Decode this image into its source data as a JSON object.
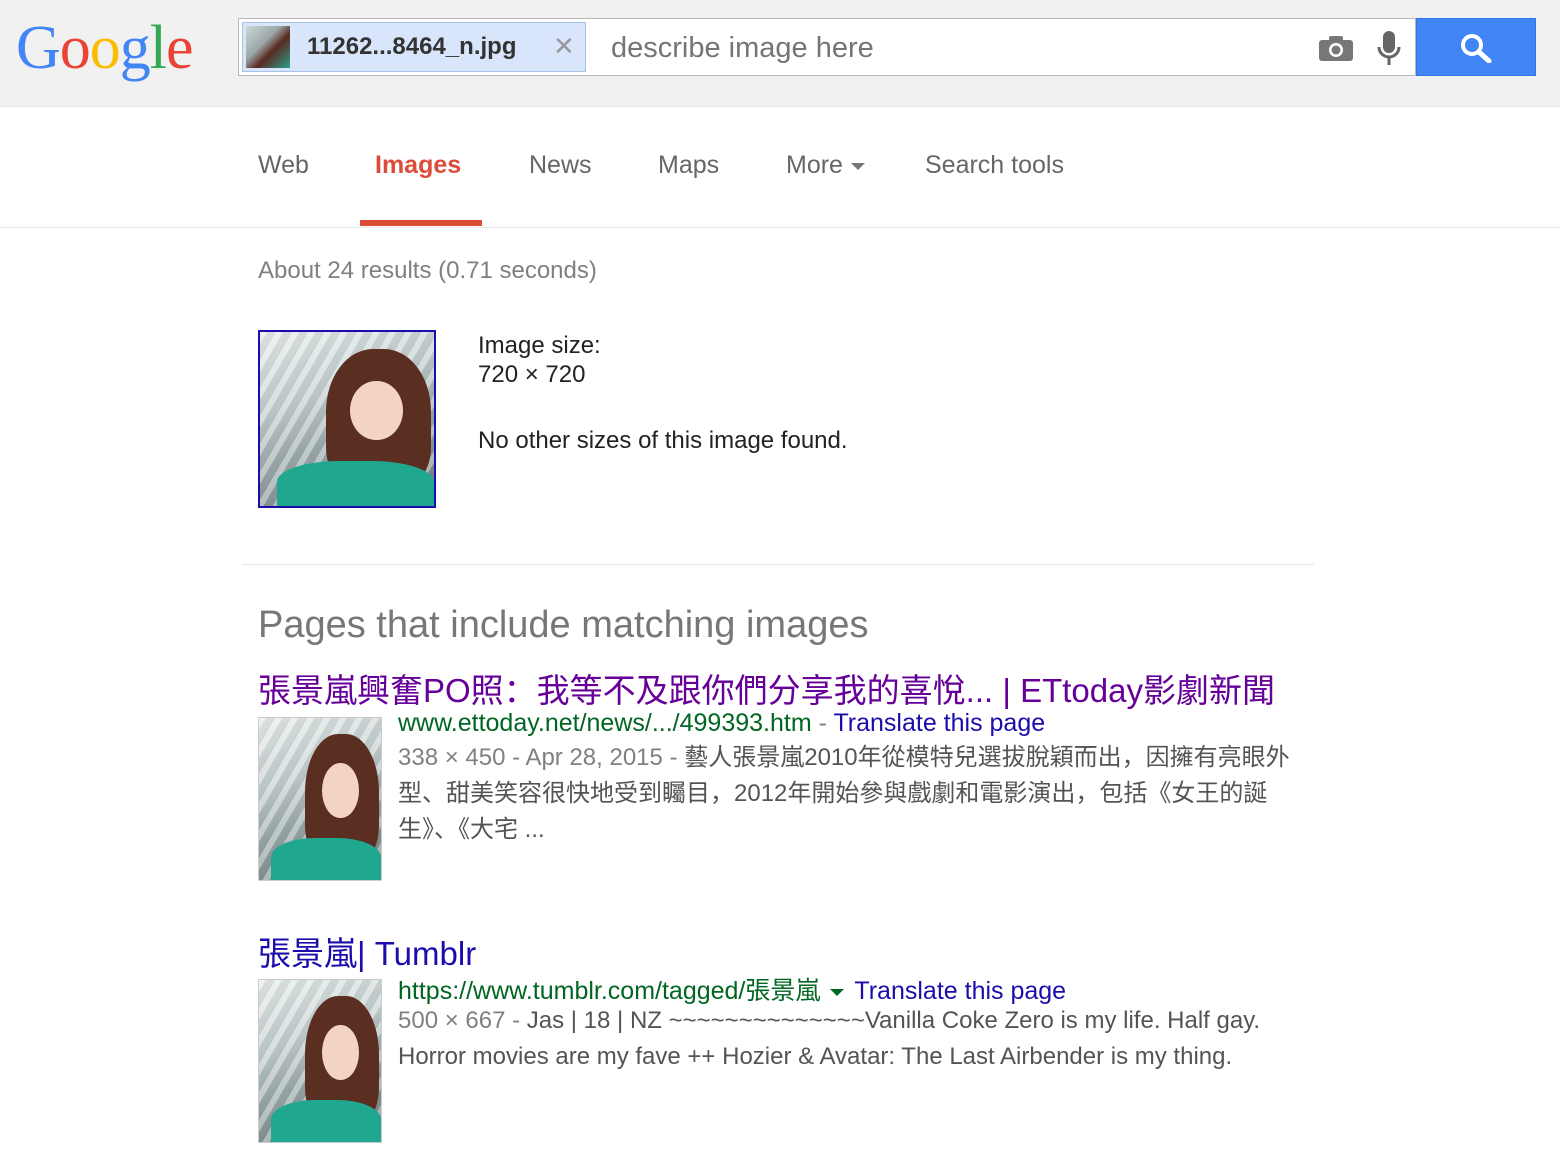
{
  "logo": {
    "text": "Google"
  },
  "search": {
    "chip_filename": "11262...8464_n.jpg",
    "placeholder": "describe image here",
    "value": ""
  },
  "tabs": [
    {
      "label": "Web",
      "active": false
    },
    {
      "label": "Images",
      "active": true
    },
    {
      "label": "News",
      "active": false
    },
    {
      "label": "Maps",
      "active": false
    },
    {
      "label": "More",
      "active": false
    },
    {
      "label": "Search tools",
      "active": false
    }
  ],
  "stats": "About 24 results (0.71 seconds)",
  "image_info": {
    "label": "Image size:",
    "size": "720 × 720",
    "note": "No other sizes of this image found."
  },
  "section_title": "Pages that include matching images",
  "results": [
    {
      "title": "張景嵐興奮PO照：我等不及跟你們分享我的喜悅... | ETtoday影劇新聞",
      "url": "www.ettoday.net/news/.../499393.htm",
      "sep": " - ",
      "translate": "Translate this page",
      "meta": "338 × 450 - Apr 28, 2015 - ",
      "snippet": "藝人張景嵐2010年從模特兒選拔脫穎而出，因擁有亮眼外型、甜美笑容很快地受到矚目，2012年開始參與戲劇和電影演出，包括《女王的誕生》、《大宅 ..."
    },
    {
      "title": "張景嵐| Tumblr",
      "url": "https://www.tumblr.com/tagged/張景嵐",
      "translate": "Translate this page",
      "meta": "500 × 667 - ",
      "snippet": "Jas | 18 | NZ ~~~~~~~~~~~~~~Vanilla Coke Zero is my life. Half gay. Horror movies are my fave ++ Hozier & Avatar: The Last Airbender is my thing."
    }
  ],
  "colors": {
    "active_tab": "#dd4b39",
    "link": "#1a0dab",
    "visited": "#660099",
    "url": "#006621",
    "search_button": "#4285f4"
  }
}
